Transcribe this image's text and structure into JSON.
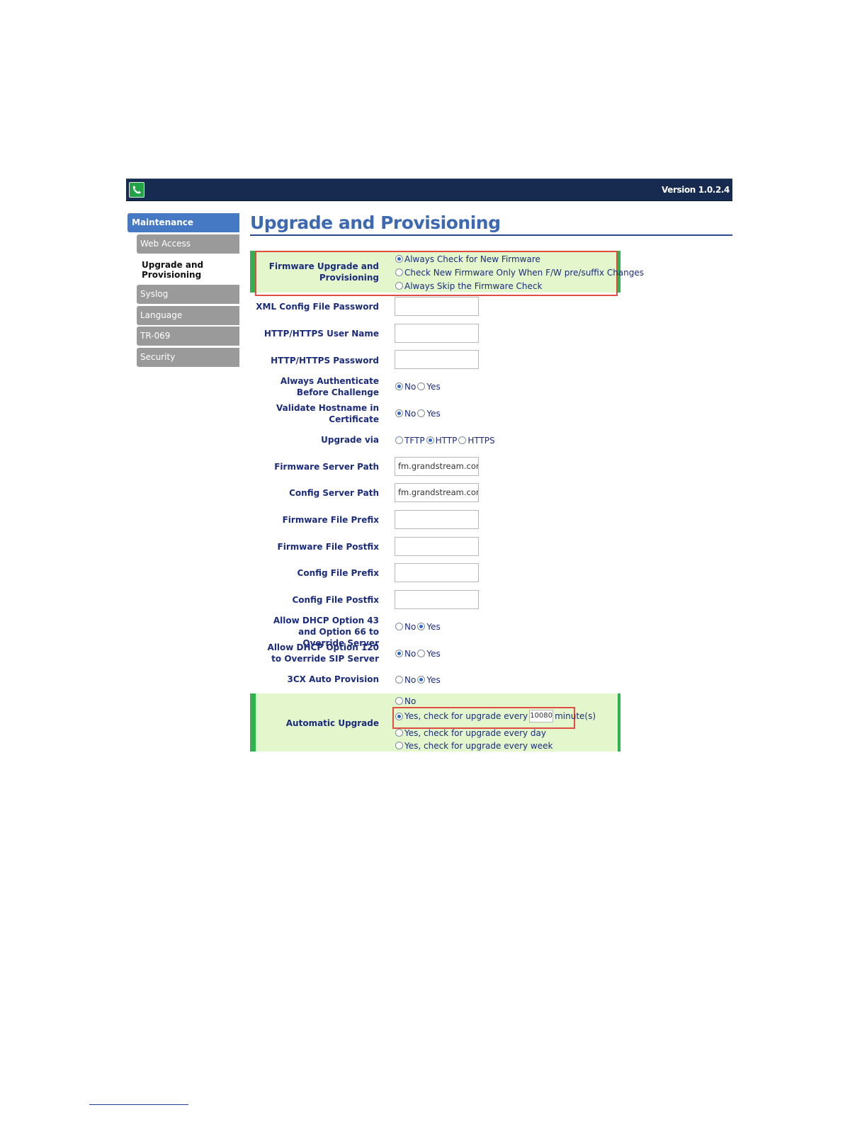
{
  "header": {
    "version": "Version 1.0.2.4"
  },
  "sidebar": {
    "heading": "Maintenance",
    "items": [
      {
        "label": "Web Access"
      },
      {
        "label": "Upgrade and Provisioning"
      },
      {
        "label": "Syslog"
      },
      {
        "label": "Language"
      },
      {
        "label": "TR-069"
      },
      {
        "label": "Security"
      }
    ]
  },
  "page": {
    "title": "Upgrade and Provisioning"
  },
  "form": {
    "firmware_upgrade": {
      "label": "Firmware Upgrade and Provisioning",
      "options": [
        {
          "label": "Always Check for New Firmware",
          "selected": true
        },
        {
          "label": "Check New Firmware Only When F/W pre/suffix Changes",
          "selected": false
        },
        {
          "label": "Always Skip the Firmware Check",
          "selected": false
        }
      ]
    },
    "xml_config_password": {
      "label": "XML Config File Password",
      "value": ""
    },
    "http_user_name": {
      "label": "HTTP/HTTPS User Name",
      "value": ""
    },
    "http_password": {
      "label": "HTTP/HTTPS Password",
      "value": ""
    },
    "always_authenticate": {
      "label": "Always Authenticate Before Challenge",
      "options": [
        "No",
        "Yes"
      ],
      "selected": "No"
    },
    "validate_hostname": {
      "label": "Validate Hostname in Certificate",
      "options": [
        "No",
        "Yes"
      ],
      "selected": "No"
    },
    "upgrade_via": {
      "label": "Upgrade via",
      "options": [
        "TFTP",
        "HTTP",
        "HTTPS"
      ],
      "selected": "HTTP"
    },
    "firmware_server_path": {
      "label": "Firmware Server Path",
      "value": "fm.grandstream.com/gs"
    },
    "config_server_path": {
      "label": "Config Server Path",
      "value": "fm.grandstream.com/gs"
    },
    "firmware_file_prefix": {
      "label": "Firmware File Prefix",
      "value": ""
    },
    "firmware_file_postfix": {
      "label": "Firmware File Postfix",
      "value": ""
    },
    "config_file_prefix": {
      "label": "Config File Prefix",
      "value": ""
    },
    "config_file_postfix": {
      "label": "Config File Postfix",
      "value": ""
    },
    "dhcp_option_43_66": {
      "label": "Allow DHCP Option 43 and Option 66 to Override Server",
      "options": [
        "No",
        "Yes"
      ],
      "selected": "Yes"
    },
    "dhcp_option_120": {
      "label": "Allow DHCP Option 120 to Override SIP Server",
      "options": [
        "No",
        "Yes"
      ],
      "selected": "No"
    },
    "auto_provision_3cx": {
      "label": "3CX Auto Provision",
      "options": [
        "No",
        "Yes"
      ],
      "selected": "Yes"
    },
    "automatic_upgrade": {
      "label": "Automatic Upgrade",
      "options": [
        {
          "label": "No",
          "selected": false
        },
        {
          "label": "Yes, check for upgrade every",
          "suffix": "minute(s)",
          "interval": "10080",
          "selected": true
        },
        {
          "label": "Yes, check for upgrade every day",
          "selected": false
        },
        {
          "label": "Yes, check for upgrade every week",
          "selected": false
        }
      ]
    }
  }
}
